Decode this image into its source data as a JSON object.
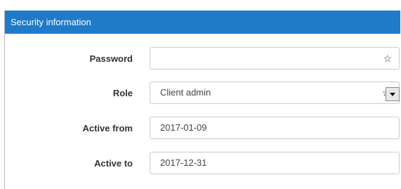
{
  "panel": {
    "title": "Security information"
  },
  "fields": {
    "password": {
      "label": "Password",
      "value": "",
      "icon": "star-icon"
    },
    "role": {
      "label": "Role",
      "value": "Client admin",
      "icon": "star-icon"
    },
    "active_from": {
      "label": "Active from",
      "value": "2017-01-09"
    },
    "active_to": {
      "label": "Active to",
      "value": "2017-12-31"
    }
  },
  "glyphs": {
    "star": "☆"
  },
  "colors": {
    "header_bg": "#1f7ac9",
    "header_text": "#ffffff",
    "border": "#cccccc"
  }
}
